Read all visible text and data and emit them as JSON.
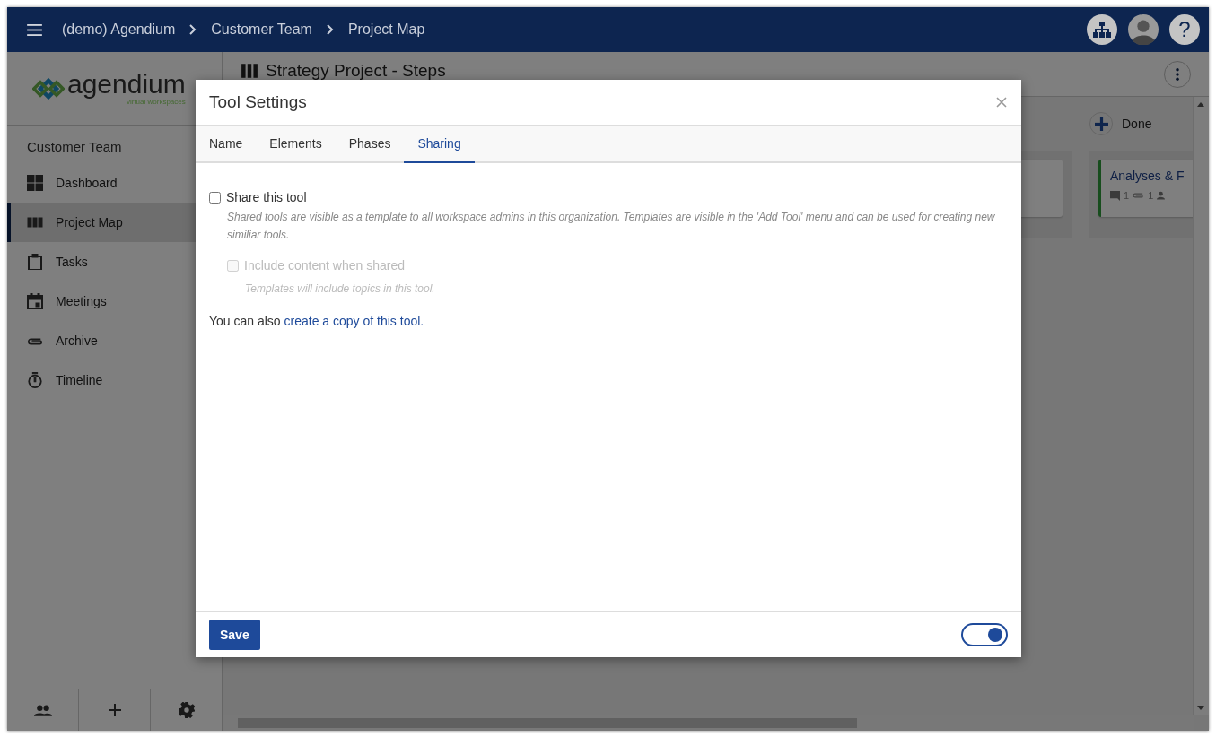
{
  "topbar": {
    "breadcrumbs": [
      "(demo) Agendium",
      "Customer Team",
      "Project Map"
    ],
    "help": "?"
  },
  "sidebar": {
    "logo": {
      "name": "agendium",
      "tagline": "virtual workspaces"
    },
    "section": "Customer Team",
    "items": [
      {
        "label": "Dashboard",
        "kind": "dashboard",
        "selected": false
      },
      {
        "label": "Project Map",
        "kind": "map",
        "selected": true
      },
      {
        "label": "Tasks",
        "kind": "tasks",
        "selected": false
      },
      {
        "label": "Meetings",
        "kind": "meetings",
        "selected": false
      },
      {
        "label": "Archive",
        "kind": "archive",
        "selected": false
      },
      {
        "label": "Timeline",
        "kind": "timeline",
        "selected": false
      }
    ]
  },
  "board": {
    "title": "Strategy Project - Steps",
    "columns": [
      {
        "title": "Done",
        "cards": [
          {
            "title": "Analyses & F",
            "comments": "1",
            "attachments": "1"
          }
        ]
      }
    ]
  },
  "dialog": {
    "title": "Tool Settings",
    "tabs": [
      {
        "label": "Name",
        "selected": false
      },
      {
        "label": "Elements",
        "selected": false
      },
      {
        "label": "Phases",
        "selected": false
      },
      {
        "label": "Sharing",
        "selected": true
      }
    ],
    "options": [
      {
        "label": "Share this tool",
        "hint": "Shared tools are visible as a template to all workspace admins in this organization. Templates are visible in the 'Add Tool' menu and can be used for creating new similiar tools.",
        "checked": false,
        "disabled": false,
        "children": [
          {
            "label": "Include content when shared",
            "hint": "Templates will include topics in this tool.",
            "checked": false,
            "disabled": true
          }
        ]
      }
    ],
    "note": {
      "text": "You can also",
      "link": "create a copy of this tool."
    },
    "save": "Save",
    "toggle": {
      "on": true
    }
  }
}
